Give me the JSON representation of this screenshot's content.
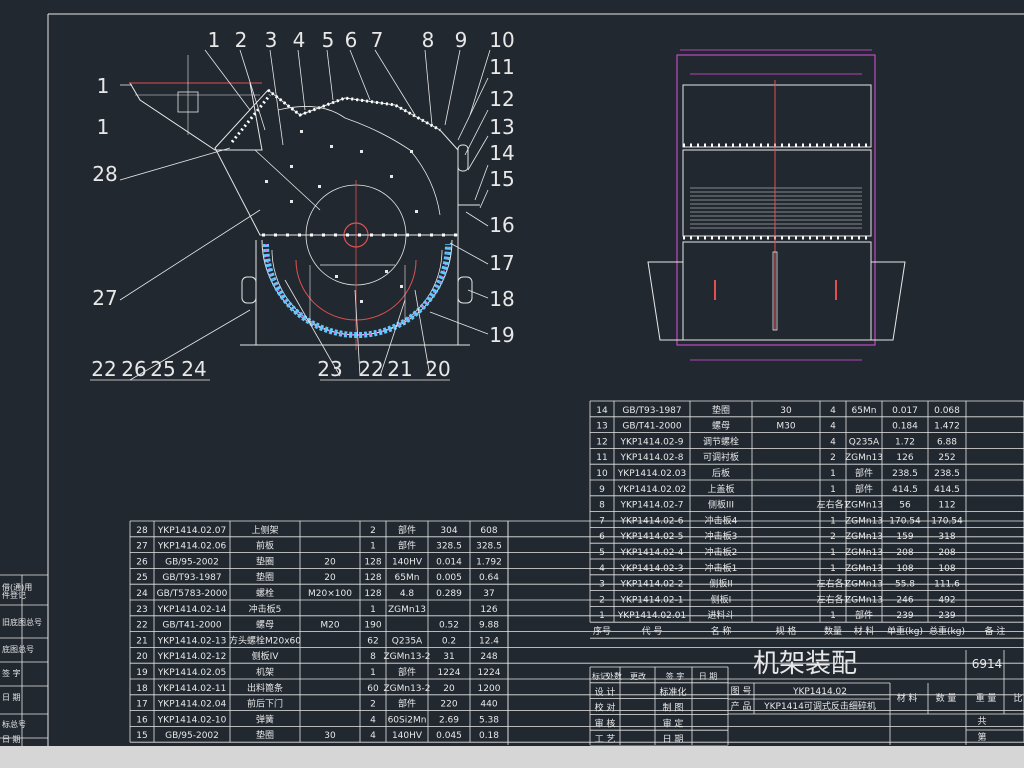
{
  "drawing": {
    "title": "机架装配",
    "mass": "6914",
    "drawing_no": "YKP1414.02",
    "product_name": "YKP1414可调式反击细碎机",
    "product_label": "产 品",
    "drawing_no_label": "图 号"
  },
  "callouts_left": [
    "1",
    "1",
    "28",
    "27",
    "22",
    "26",
    "25",
    "24"
  ],
  "callouts_top": [
    "1",
    "2",
    "3",
    "4",
    "5",
    "6",
    "7",
    "8",
    "9",
    "10"
  ],
  "callouts_right": [
    "11",
    "12",
    "13",
    "14",
    "15",
    "16",
    "17",
    "18",
    "19"
  ],
  "callouts_bottom": [
    "23",
    "22",
    "21",
    "20"
  ],
  "bom_header": {
    "seq": "序号",
    "code": "代 号",
    "name": "名 称",
    "spec": "规 格",
    "qty": "数量",
    "material": "材 料",
    "unit_wt": "单重(kg)",
    "total_wt": "总重(kg)",
    "remark": "备 注"
  },
  "bom_right": [
    {
      "no": "14",
      "code": "GB/T93-1987",
      "name": "垫圈",
      "spec": "30",
      "qty": "4",
      "mat": "65Mn",
      "uw": "0.017",
      "tw": "0.068"
    },
    {
      "no": "13",
      "code": "GB/T41-2000",
      "name": "螺母",
      "spec": "M30",
      "qty": "4",
      "mat": "",
      "uw": "0.184",
      "tw": "1.472"
    },
    {
      "no": "12",
      "code": "YKP1414.02-9",
      "name": "调节螺栓",
      "spec": "",
      "qty": "4",
      "mat": "Q235A",
      "uw": "1.72",
      "tw": "6.88"
    },
    {
      "no": "11",
      "code": "YKP1414.02-8",
      "name": "可调衬板",
      "spec": "",
      "qty": "2",
      "mat": "ZGMn13",
      "uw": "126",
      "tw": "252"
    },
    {
      "no": "10",
      "code": "YKP1414.02.03",
      "name": "后板",
      "spec": "",
      "qty": "1",
      "mat": "部件",
      "uw": "238.5",
      "tw": "238.5"
    },
    {
      "no": "9",
      "code": "YKP1414.02.02",
      "name": "上盖板",
      "spec": "",
      "qty": "1",
      "mat": "部件",
      "uw": "414.5",
      "tw": "414.5"
    },
    {
      "no": "8",
      "code": "YKP1414.02-7",
      "name": "侧板III",
      "spec": "",
      "qty": "左右各1",
      "mat": "ZGMn13",
      "uw": "56",
      "tw": "112"
    },
    {
      "no": "7",
      "code": "YKP1414.02-6",
      "name": "冲击板4",
      "spec": "",
      "qty": "1",
      "mat": "ZGMn13",
      "uw": "170.54",
      "tw": "170.54"
    },
    {
      "no": "6",
      "code": "YKP1414.02-5",
      "name": "冲击板3",
      "spec": "",
      "qty": "2",
      "mat": "ZGMn13",
      "uw": "159",
      "tw": "318"
    },
    {
      "no": "5",
      "code": "YKP1414.02-4",
      "name": "冲击板2",
      "spec": "",
      "qty": "1",
      "mat": "ZGMn13",
      "uw": "208",
      "tw": "208"
    },
    {
      "no": "4",
      "code": "YKP1414.02-3",
      "name": "冲击板1",
      "spec": "",
      "qty": "1",
      "mat": "ZGMn13",
      "uw": "108",
      "tw": "108"
    },
    {
      "no": "3",
      "code": "YKP1414.02-2",
      "name": "侧板II",
      "spec": "",
      "qty": "左右各1",
      "mat": "ZGMn13",
      "uw": "55.8",
      "tw": "111.6"
    },
    {
      "no": "2",
      "code": "YKP1414.02-1",
      "name": "侧板I",
      "spec": "",
      "qty": "左右各1",
      "mat": "ZGMn13",
      "uw": "246",
      "tw": "492"
    },
    {
      "no": "1",
      "code": "YKP1414.02.01",
      "name": "进料斗",
      "spec": "",
      "qty": "1",
      "mat": "部件",
      "uw": "239",
      "tw": "239"
    }
  ],
  "bom_left": [
    {
      "no": "28",
      "code": "YKP1414.02.07",
      "name": "上侧架",
      "spec": "",
      "qty": "2",
      "mat": "部件",
      "uw": "304",
      "tw": "608"
    },
    {
      "no": "27",
      "code": "YKP1414.02.06",
      "name": "前板",
      "spec": "",
      "qty": "1",
      "mat": "部件",
      "uw": "328.5",
      "tw": "328.5"
    },
    {
      "no": "26",
      "code": "GB/95-2002",
      "name": "垫圈",
      "spec": "20",
      "qty": "128",
      "mat": "140HV",
      "uw": "0.014",
      "tw": "1.792"
    },
    {
      "no": "25",
      "code": "GB/T93-1987",
      "name": "垫圈",
      "spec": "20",
      "qty": "128",
      "mat": "65Mn",
      "uw": "0.005",
      "tw": "0.64"
    },
    {
      "no": "24",
      "code": "GB/T5783-2000",
      "name": "螺栓",
      "spec": "M20×100",
      "qty": "128",
      "mat": "4.8",
      "uw": "0.289",
      "tw": "37"
    },
    {
      "no": "23",
      "code": "YKP1414.02-14",
      "name": "冲击板5",
      "spec": "",
      "qty": "1",
      "mat": "ZGMn13",
      "uw": "",
      "tw": "126"
    },
    {
      "no": "22",
      "code": "GB/T41-2000",
      "name": "螺母",
      "spec": "M20",
      "qty": "190",
      "mat": "",
      "uw": "0.52",
      "tw": "9.88"
    },
    {
      "no": "21",
      "code": "YKP1414.02-13",
      "name": "方头螺栓M20x60",
      "spec": "",
      "qty": "62",
      "mat": "Q235A",
      "uw": "0.2",
      "tw": "12.4"
    },
    {
      "no": "20",
      "code": "YKP1414.02-12",
      "name": "侧板IV",
      "spec": "",
      "qty": "8",
      "mat": "ZGMn13-2",
      "uw": "31",
      "tw": "248"
    },
    {
      "no": "19",
      "code": "YKP1414.02.05",
      "name": "机架",
      "spec": "",
      "qty": "1",
      "mat": "部件",
      "uw": "1224",
      "tw": "1224"
    },
    {
      "no": "18",
      "code": "YKP1414.02-11",
      "name": "出料篦条",
      "spec": "",
      "qty": "60",
      "mat": "ZGMn13-2",
      "uw": "20",
      "tw": "1200"
    },
    {
      "no": "17",
      "code": "YKP1414.02.04",
      "name": "前后下门",
      "spec": "",
      "qty": "2",
      "mat": "部件",
      "uw": "220",
      "tw": "440"
    },
    {
      "no": "16",
      "code": "YKP1414.02-10",
      "name": "弹簧",
      "spec": "",
      "qty": "4",
      "mat": "60Si2Mn",
      "uw": "2.69",
      "tw": "5.38"
    },
    {
      "no": "15",
      "code": "GB/95-2002",
      "name": "垫圈",
      "spec": "30",
      "qty": "4",
      "mat": "140HV",
      "uw": "0.045",
      "tw": "0.18"
    }
  ],
  "title_block_labels": {
    "mark": "标记",
    "count": "处数",
    "change": "更改",
    "sign": "签 字",
    "date": "日 期",
    "design": "设 计",
    "std": "标准化",
    "check": "校 对",
    "draw": "制 图",
    "review": "审 核",
    "audit": "审 定",
    "process": "工 艺",
    "date2": "日 期",
    "material": "材 料",
    "quantity": "数 量",
    "weight": "重 量",
    "ratio": "比",
    "total": "共",
    "sheet": "第"
  },
  "left_margin_labels": [
    "借(通)用",
    "件登记",
    "旧底图总号",
    "底图总号",
    "签 字",
    "日 期",
    "标总号",
    "日 期"
  ]
}
